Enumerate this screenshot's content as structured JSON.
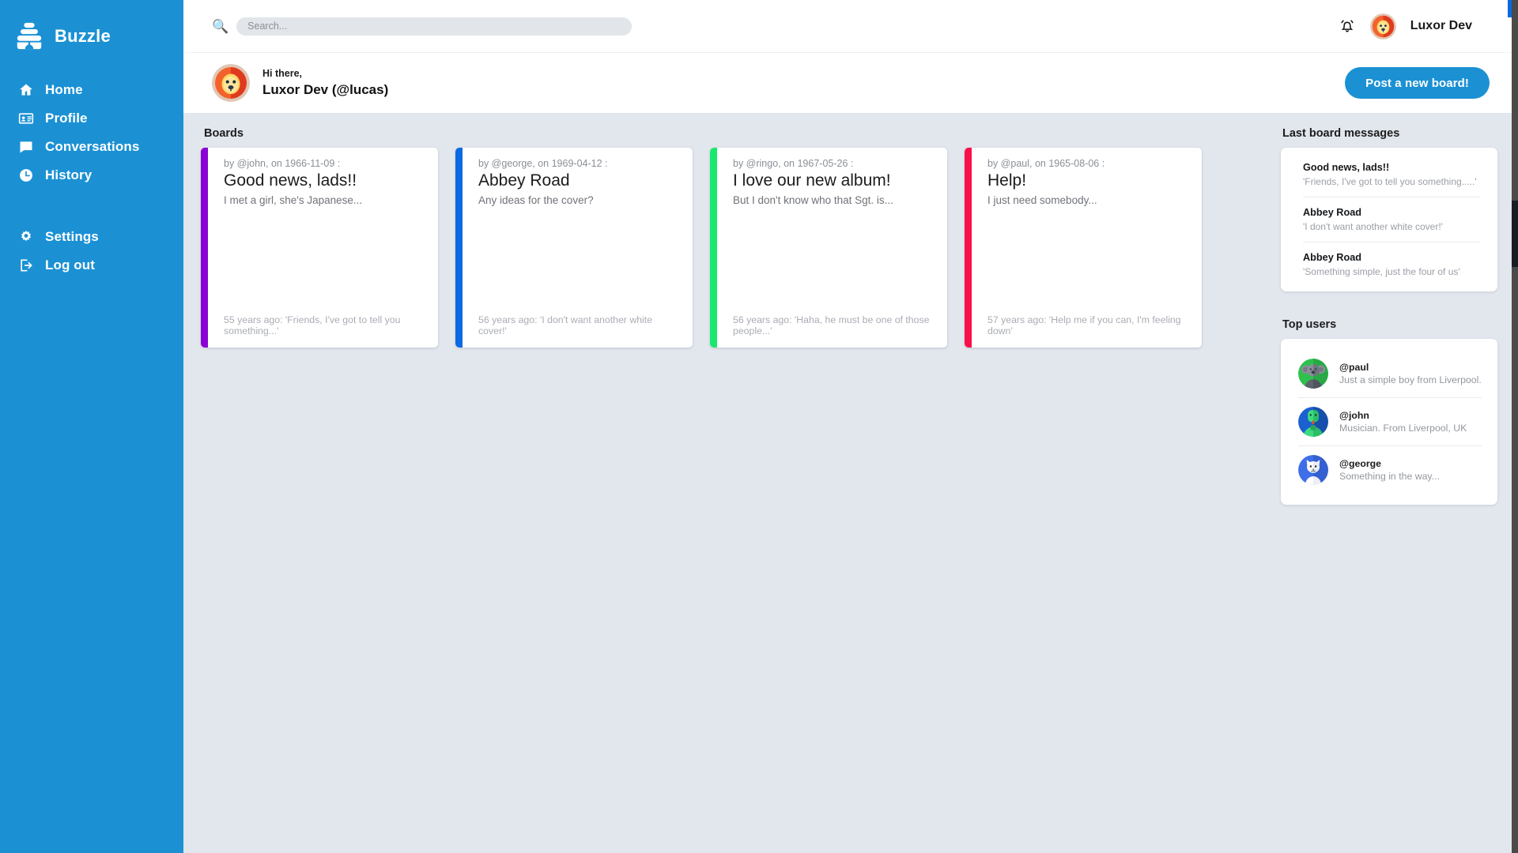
{
  "brand": {
    "name": "Buzzle",
    "logo_icon": "hive-logo-icon"
  },
  "sidebar": {
    "items": [
      {
        "label": "Home",
        "icon": "home-icon"
      },
      {
        "label": "Profile",
        "icon": "id-card-icon"
      },
      {
        "label": "Conversations",
        "icon": "chat-bubble-icon"
      },
      {
        "label": "History",
        "icon": "clock-icon"
      }
    ],
    "bottom_items": [
      {
        "label": "Settings",
        "icon": "gear-icon"
      },
      {
        "label": "Log out",
        "icon": "logout-icon"
      }
    ]
  },
  "topbar": {
    "search_icon": "search-icon",
    "search_value": "",
    "search_placeholder": "Search...",
    "bell_icon": "bell-icon",
    "avatar_icon": "lion-avatar",
    "username": "Luxor Dev"
  },
  "greeting": {
    "avatar_icon": "lion-avatar",
    "hi": "Hi there,",
    "name": "Luxor Dev (@lucas)",
    "post_button": "Post a new board!"
  },
  "main": {
    "boards_heading": "Boards",
    "boards": [
      {
        "meta": "by @john, on 1966-11-09 :",
        "title": "Good news, lads!!",
        "excerpt": "I met a girl, she's Japanese...",
        "footer": "55 years ago: 'Friends, I've got to tell you something...'",
        "accent": "#8a00d4"
      },
      {
        "meta": "by @george, on 1969-04-12 :",
        "title": "Abbey Road",
        "excerpt": "Any ideas for the cover?",
        "footer": "56 years ago: 'I don't want another white cover!'",
        "accent": "#0b69e3"
      },
      {
        "meta": "by @ringo, on 1967-05-26 :",
        "title": "I love our new album!",
        "excerpt": "But I don't know who that Sgt. is...",
        "footer": "56 years ago: 'Haha, he must be one of those people...'",
        "accent": "#18e96e"
      },
      {
        "meta": "by @paul, on 1965-08-06 :",
        "title": "Help!",
        "excerpt": "I just need somebody...",
        "footer": "57 years ago: 'Help me if you can, I'm feeling down'",
        "accent": "#f9104b"
      }
    ]
  },
  "rightbar": {
    "messages_heading": "Last board messages",
    "messages": [
      {
        "title": "Good news, lads!!",
        "text": "'Friends, I've got to tell you something.....'"
      },
      {
        "title": "Abbey Road",
        "text": "'I don't want another white cover!'"
      },
      {
        "title": "Abbey Road",
        "text": "'Something simple, just the four of us'"
      }
    ],
    "users_heading": "Top users",
    "users": [
      {
        "handle": "@paul",
        "bio": "Just a simple boy from Liverpool.",
        "avatar_icon": "koala-avatar",
        "avatar_bg": "#2ec14e"
      },
      {
        "handle": "@john",
        "bio": "Musician. From Liverpool, UK",
        "avatar_icon": "frog-avatar",
        "avatar_bg": "#1c5fd1"
      },
      {
        "handle": "@george",
        "bio": "Something in the way...",
        "avatar_icon": "cat-avatar",
        "avatar_bg": "#3f6fe8"
      }
    ]
  },
  "theme": {
    "sidebar_bg": "#1b91d4",
    "page_bg": "#e2e6ed",
    "accent": "#1b91d4"
  }
}
